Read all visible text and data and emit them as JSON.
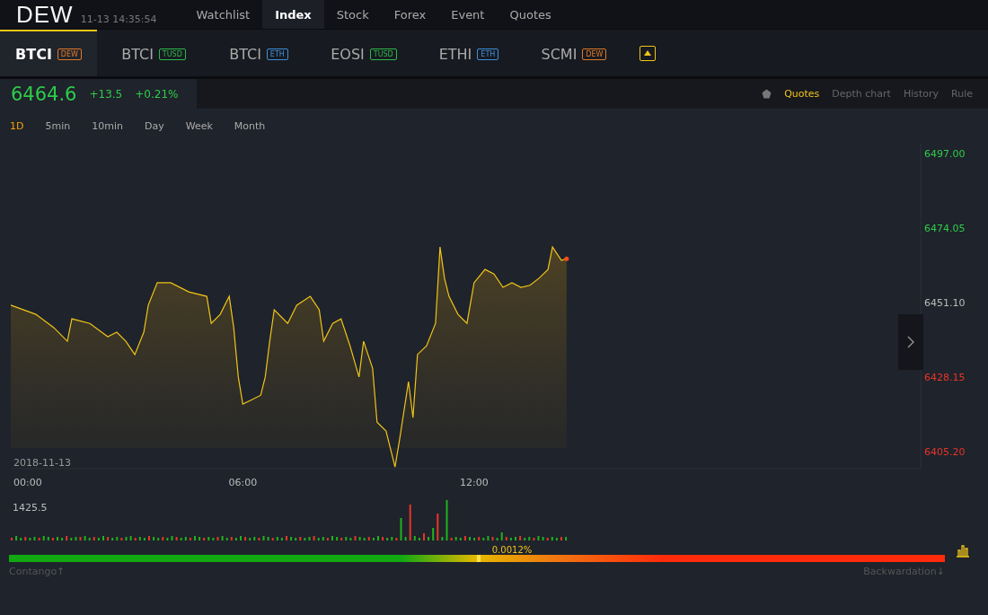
{
  "header": {
    "logo": "DEW",
    "datetime": "11-13 14:35:54",
    "nav": [
      {
        "label": "Watchlist",
        "selected": false
      },
      {
        "label": "Index",
        "selected": true
      },
      {
        "label": "Stock",
        "selected": false
      },
      {
        "label": "Forex",
        "selected": false
      },
      {
        "label": "Event",
        "selected": false
      },
      {
        "label": "Quotes",
        "selected": false
      }
    ]
  },
  "tabs": [
    {
      "label": "BTCI",
      "badge": "DEW",
      "color": "#e0782a",
      "selected": true
    },
    {
      "label": "BTCI",
      "badge": "TUSD",
      "color": "#2db84a",
      "selected": false
    },
    {
      "label": "BTCI",
      "badge": "ETH",
      "color": "#3b8fd9",
      "selected": false
    },
    {
      "label": "EOSI",
      "badge": "TUSD",
      "color": "#2db84a",
      "selected": false
    },
    {
      "label": "ETHI",
      "badge": "ETH",
      "color": "#3b8fd9",
      "selected": false
    },
    {
      "label": "SCMI",
      "badge": "DEW",
      "color": "#e0782a",
      "selected": false
    }
  ],
  "quote": {
    "price": "6464.6",
    "change": "+13.5",
    "change_percent": "+0.21%"
  },
  "views": [
    {
      "label": "Quotes",
      "selected": true
    },
    {
      "label": "Depth chart",
      "selected": false
    },
    {
      "label": "History",
      "selected": false
    },
    {
      "label": "Rule",
      "selected": false
    }
  ],
  "periods": [
    {
      "label": "1D",
      "selected": true
    },
    {
      "label": "5min",
      "selected": false
    },
    {
      "label": "10min",
      "selected": false
    },
    {
      "label": "Day",
      "selected": false
    },
    {
      "label": "Week",
      "selected": false
    },
    {
      "label": "Month",
      "selected": false
    }
  ],
  "price_chart": {
    "date_label": "2018-11-13",
    "chart_data": {
      "type": "area",
      "x": [
        0,
        39,
        67,
        88,
        95,
        123,
        151,
        165,
        179,
        193,
        207,
        214,
        228,
        249,
        277,
        305,
        312,
        326,
        340,
        347,
        354,
        361,
        375,
        389,
        396,
        403,
        410,
        431,
        445,
        466,
        480,
        487,
        501,
        514,
        528,
        542,
        549,
        563,
        570,
        584,
        598,
        605,
        619,
        626,
        633,
        647,
        661,
        668,
        675,
        682,
        696,
        710,
        721,
        738,
        752,
        766,
        780,
        794,
        808,
        822,
        836,
        843,
        857,
        865
      ],
      "series": [
        {
          "color": "#f0c419",
          "values": [
            6450.3,
            6447.5,
            6443.4,
            6439.2,
            6446.1,
            6444.7,
            6440.6,
            6442.0,
            6439.2,
            6435.1,
            6442.0,
            6450.3,
            6457.2,
            6457.2,
            6454.4,
            6453.0,
            6444.7,
            6447.5,
            6453.0,
            6443.4,
            6428.2,
            6419.9,
            6421.2,
            6422.6,
            6428.2,
            6439.2,
            6448.9,
            6444.7,
            6450.3,
            6453.0,
            6448.9,
            6439.2,
            6444.7,
            6446.1,
            6437.8,
            6428.2,
            6439.2,
            6430.9,
            6414.3,
            6411.6,
            6400.5,
            6408.8,
            6426.8,
            6415.7,
            6435.1,
            6437.8,
            6444.7,
            6468.2,
            6458.6,
            6453.0,
            6447.5,
            6444.7,
            6457.2,
            6461.3,
            6459.9,
            6455.8,
            6457.2,
            6455.8,
            6456.4,
            6458.6,
            6461.3,
            6468.2,
            6464.1,
            6464.6
          ]
        }
      ],
      "xlim": [
        0,
        1416
      ],
      "ylim": [
        6400,
        6500
      ],
      "xticks": [
        {
          "value": 0,
          "label": "00:00"
        },
        {
          "value": 360,
          "label": "06:00"
        },
        {
          "value": 720,
          "label": "12:00"
        }
      ],
      "yticks": [
        {
          "value": 6497,
          "label": "6497.00"
        },
        {
          "value": 6474.05,
          "label": "6474.05"
        },
        {
          "value": 6451.1,
          "label": "6451.10"
        },
        {
          "value": 6428.15,
          "label": "6428.15"
        },
        {
          "value": 6405.2,
          "label": "6405.20"
        }
      ]
    }
  },
  "volume": {
    "max_label": "1425.5"
  },
  "basis": {
    "reading": "0.0012%",
    "level": 0.502,
    "left_label": "Contango↑",
    "right_label": "Backwardation↓"
  }
}
